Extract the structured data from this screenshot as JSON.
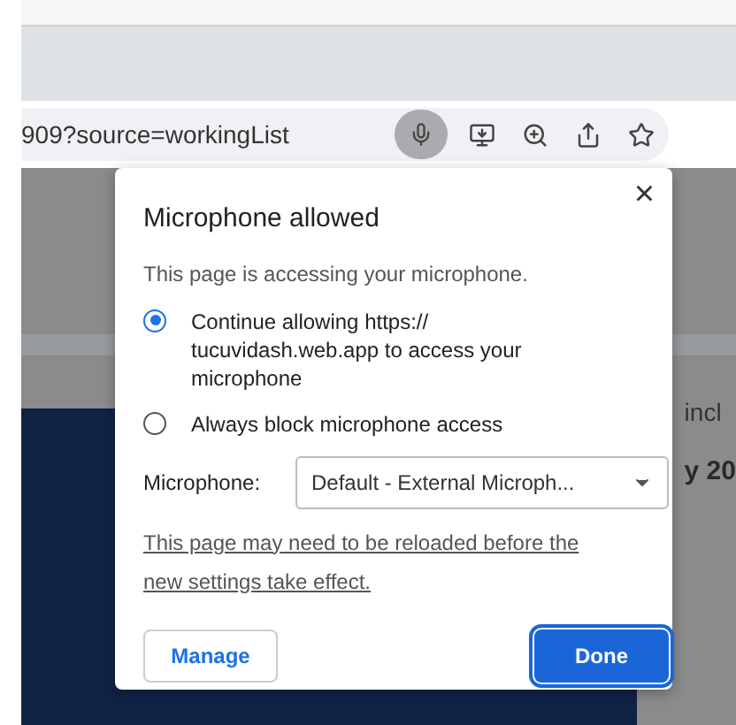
{
  "address_bar": {
    "url": "909?source=workingList",
    "mic_active": true
  },
  "background_page": {
    "texts": [
      "incl",
      "y 20"
    ]
  },
  "dialog": {
    "title": "Microphone allowed",
    "close": "×",
    "description": "This page is accessing your microphone.",
    "options": [
      {
        "label": "Continue allowing https:// tucuvidash.web.app to access your microphone",
        "selected": true
      },
      {
        "label": "Always block microphone access",
        "selected": false
      }
    ],
    "device_label": "Microphone:",
    "device_value": "Default - External Microph...",
    "note": "This page may need to be reloaded before the new settings take effect.",
    "buttons": [
      {
        "label": "Manage",
        "kind": "secondary"
      },
      {
        "label": "Done",
        "kind": "primary"
      }
    ]
  }
}
